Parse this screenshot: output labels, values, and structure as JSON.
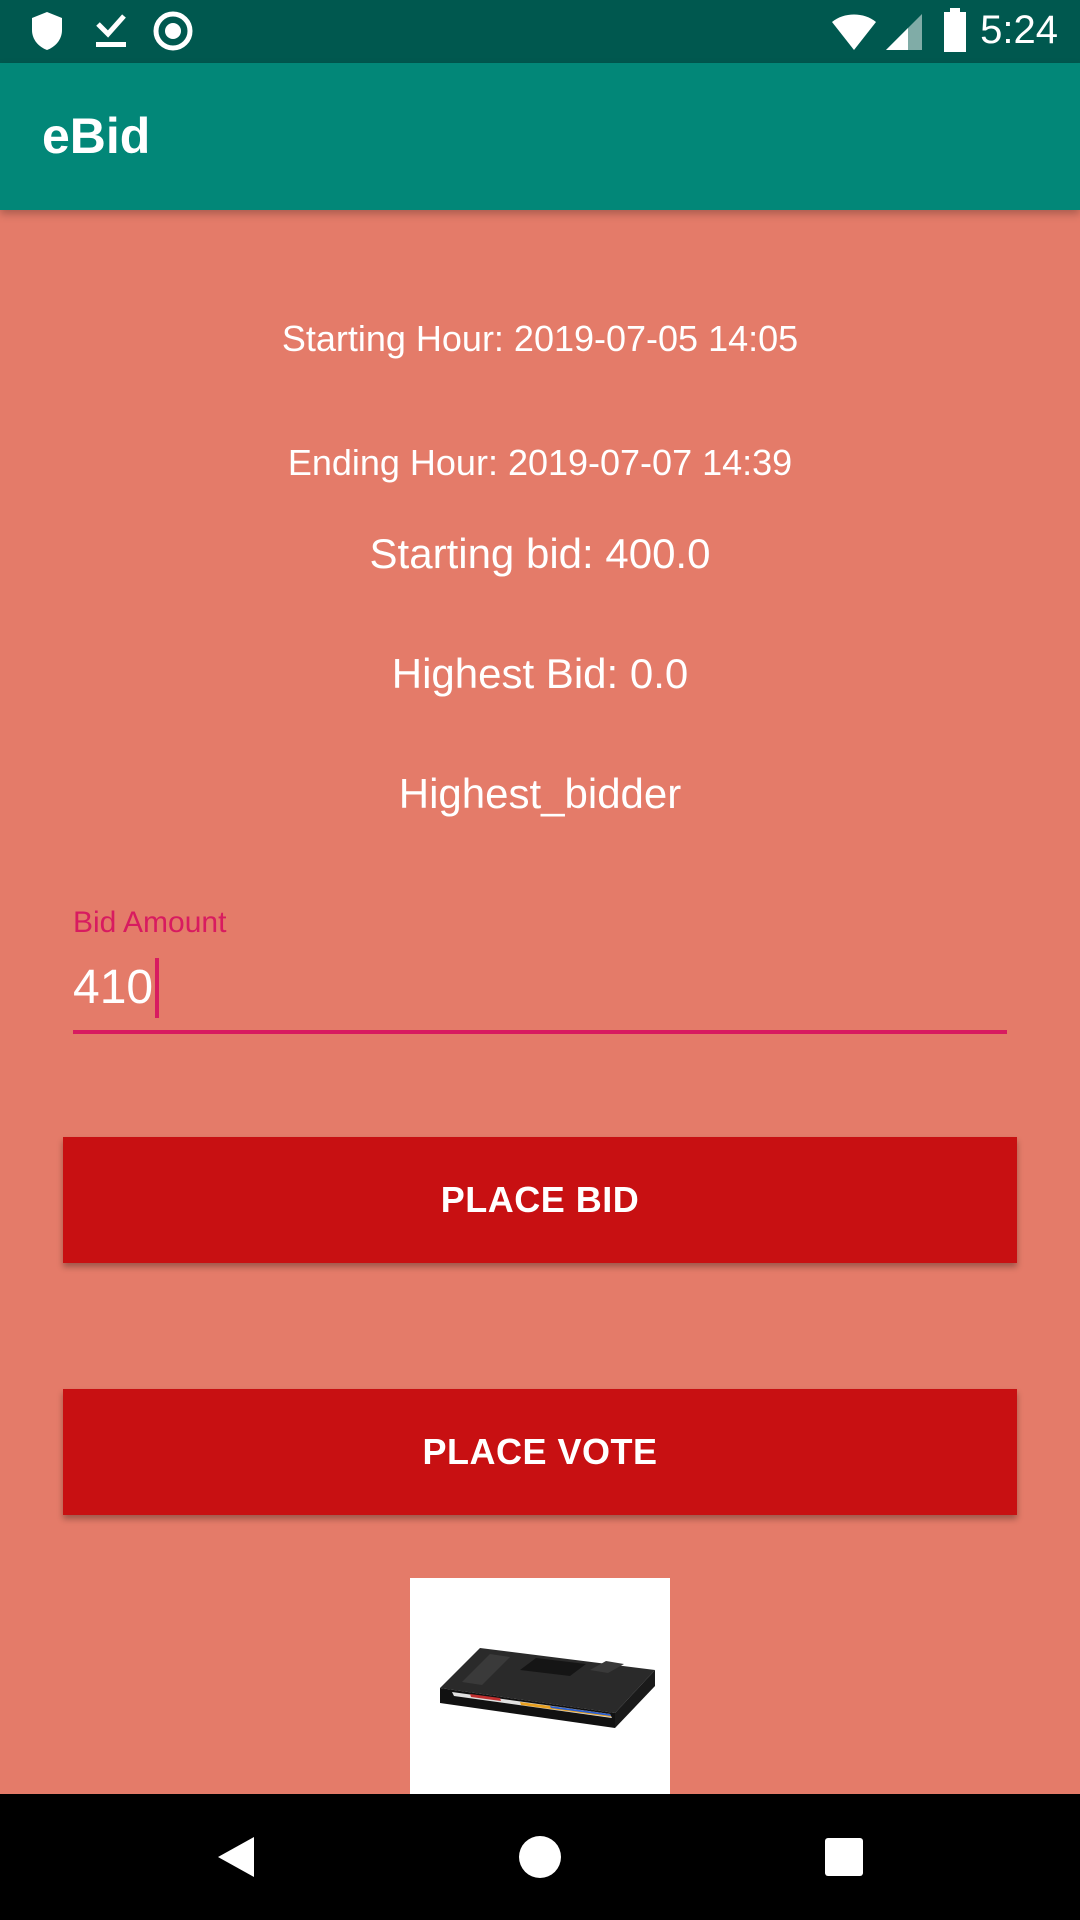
{
  "status_bar": {
    "time": "5:24",
    "icons_left": [
      "shield-icon",
      "download-done-icon",
      "circle-record-icon"
    ],
    "icons_right": [
      "wifi-icon",
      "signal-icon",
      "battery-icon"
    ]
  },
  "app_bar": {
    "title": "eBid"
  },
  "auction": {
    "starting_hour": "Starting Hour: 2019-07-05 14:05",
    "ending_hour": "Ending Hour: 2019-07-07 14:39",
    "starting_bid": "Starting bid: 400.0",
    "highest_bid": "Highest Bid: 0.0",
    "highest_bidder": "Highest_bidder"
  },
  "bid_input": {
    "label": "Bid Amount",
    "value": "410"
  },
  "buttons": {
    "place_bid": "PLACE BID",
    "place_vote": "PLACE VOTE"
  },
  "colors": {
    "background": "#e47b69",
    "app_bar": "#028778",
    "status_bar": "#00584f",
    "button": "#c81012",
    "accent": "#d81b60"
  },
  "nav_bar": {
    "icons": [
      "back-icon",
      "home-icon",
      "recents-icon"
    ]
  }
}
